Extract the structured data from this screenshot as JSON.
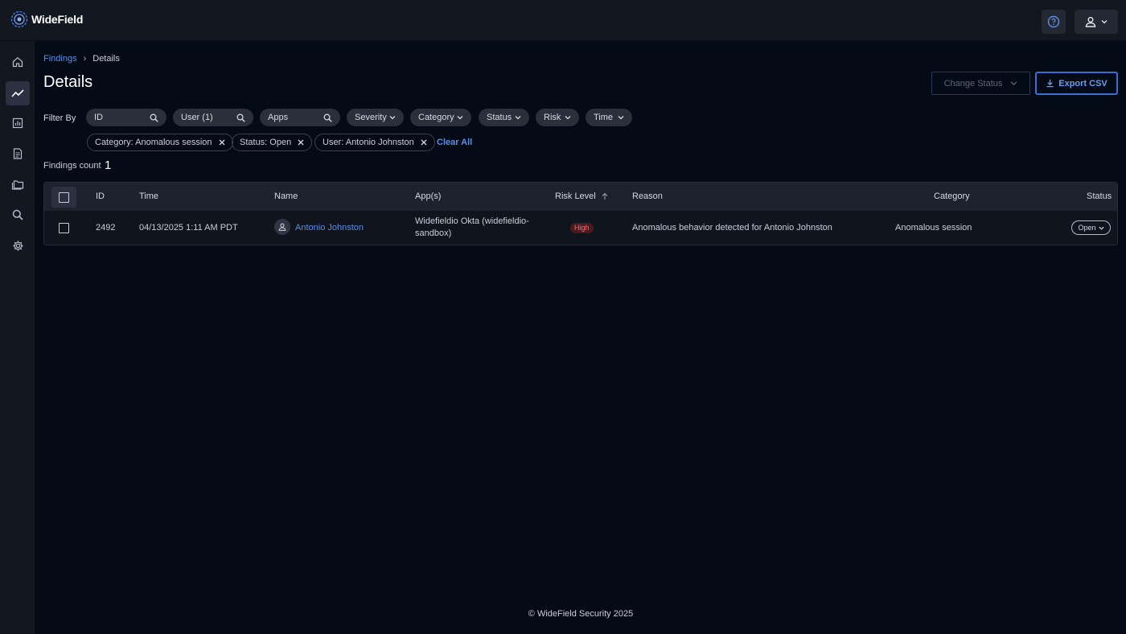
{
  "app": {
    "name": "WideField"
  },
  "breadcrumb": {
    "parent": "Findings",
    "separator": "›",
    "current": "Details"
  },
  "page": {
    "title": "Details"
  },
  "actions": {
    "change_status": "Change Status",
    "export_csv": "Export CSV"
  },
  "filters": {
    "label": "Filter By",
    "search_pills": [
      {
        "label": "ID"
      },
      {
        "label": "User (1)"
      },
      {
        "label": "Apps"
      }
    ],
    "dropdown_pills": [
      {
        "label": "Severity"
      },
      {
        "label": "Category"
      },
      {
        "label": "Status"
      },
      {
        "label": "Risk"
      },
      {
        "label": "Time"
      }
    ],
    "active_chips": [
      {
        "label": "Category: Anomalous session"
      },
      {
        "label": "Status: Open"
      },
      {
        "label": "User: Antonio Johnston"
      }
    ],
    "clear_all": "Clear All"
  },
  "findings": {
    "count_label": "Findings count",
    "count": "1"
  },
  "table": {
    "columns": [
      "ID",
      "Time",
      "Name",
      "App(s)",
      "Risk Level",
      "Reason",
      "Category",
      "Status"
    ],
    "rows": [
      {
        "id": "2492",
        "time": "04/13/2025 1:11 AM PDT",
        "name": "Antonio Johnston",
        "apps_line1": "Widefieldio Okta (widefieldio-",
        "apps_line2": "sandbox)",
        "risk": "High",
        "reason": "Anomalous behavior detected for Antonio Johnston",
        "category": "Anomalous session",
        "status": "Open"
      }
    ]
  },
  "footer": {
    "text": "© WideField Security 2025"
  },
  "colors": {
    "accent": "#3a6fd1",
    "link": "#5b8ee6",
    "risk_high": "#ff6b6b"
  }
}
